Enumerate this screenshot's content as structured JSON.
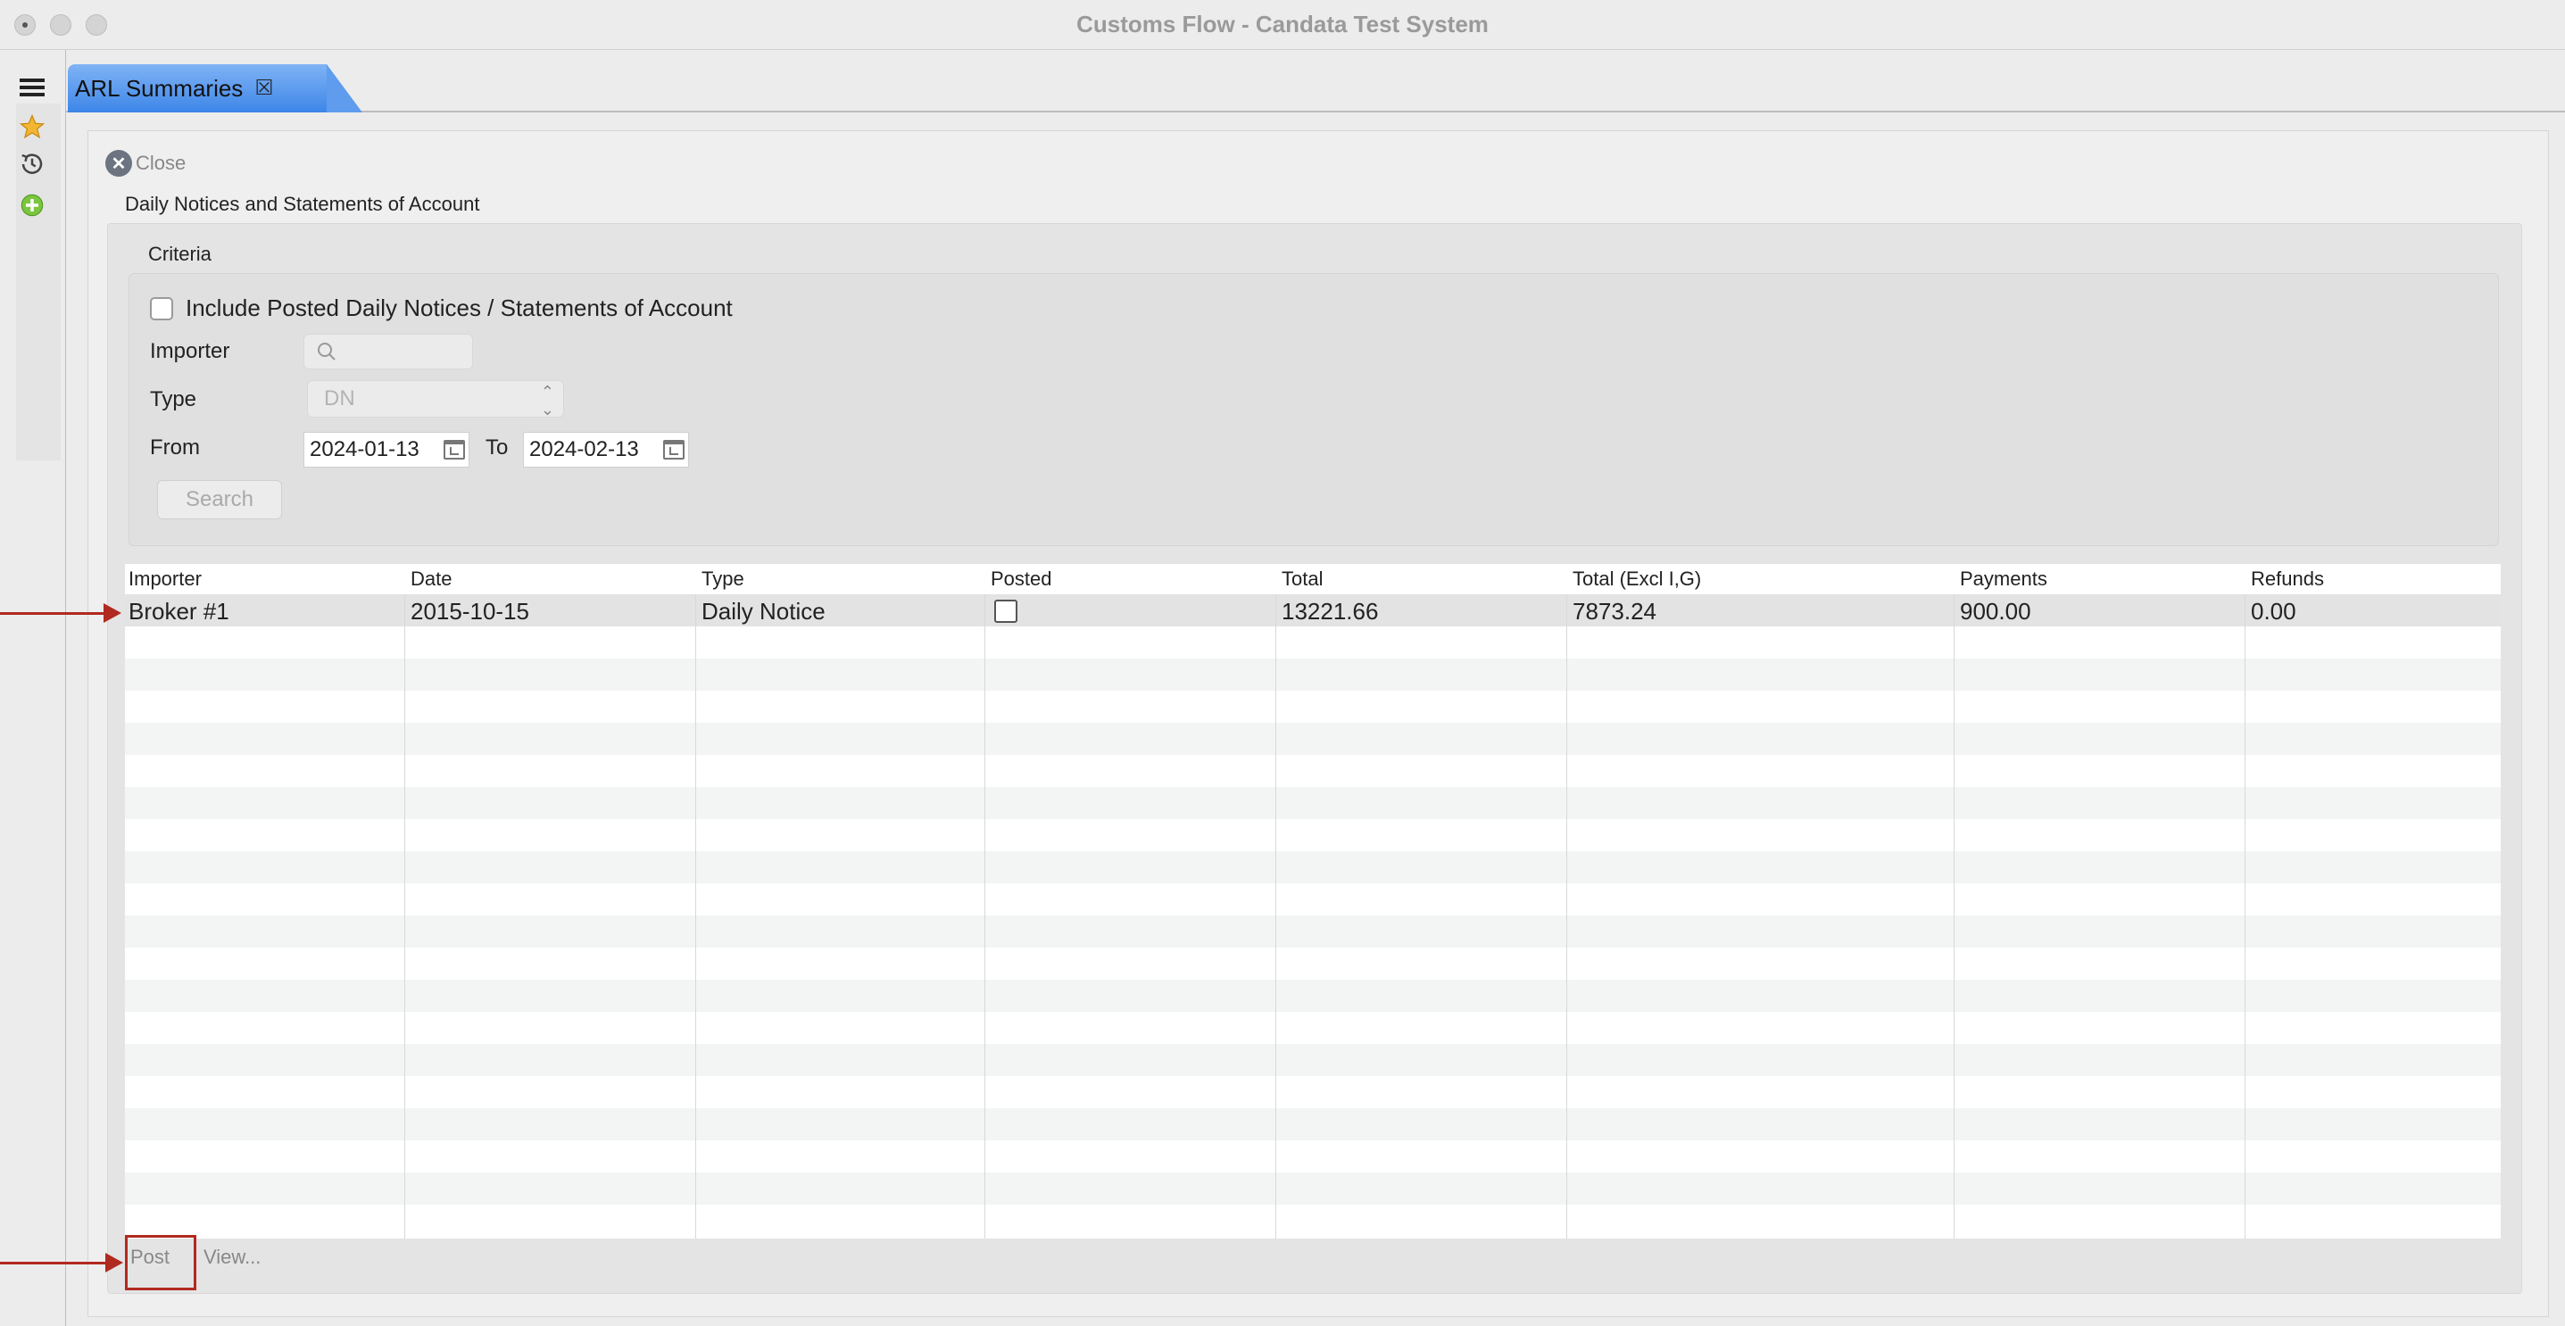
{
  "window": {
    "title": "Customs Flow - Candata Test System"
  },
  "leftbar": {
    "icons": [
      "menu-icon",
      "star-icon",
      "history-icon",
      "add-icon"
    ]
  },
  "tab": {
    "label": "ARL Summaries",
    "close_glyph": "⮽"
  },
  "page": {
    "close_label": "Close",
    "section_title": "Daily Notices and Statements of Account"
  },
  "criteria": {
    "title": "Criteria",
    "include_posted_label": "Include Posted Daily Notices / Statements of Account",
    "include_posted_checked": false,
    "importer_label": "Importer",
    "importer_value": "",
    "type_label": "Type",
    "type_value": "DN",
    "from_label": "From",
    "from_value": "2024-01-13",
    "to_label": "To",
    "to_value": "2024-02-13",
    "search_label": "Search"
  },
  "table": {
    "columns": [
      "Importer",
      "Date",
      "Type",
      "Posted",
      "Total",
      "Total (Excl I,G)",
      "Payments",
      "Refunds"
    ],
    "rows": [
      {
        "importer": "Broker #1",
        "date": "2015-10-15",
        "type": "Daily Notice",
        "posted": false,
        "total": "13221.66",
        "total_excl": "7873.24",
        "payments": "900.00",
        "refunds": "0.00"
      }
    ]
  },
  "actions": {
    "post_label": "Post",
    "view_label": "View..."
  },
  "colors": {
    "tab_accent": "#3d86e8",
    "annotation": "#b12a20"
  }
}
